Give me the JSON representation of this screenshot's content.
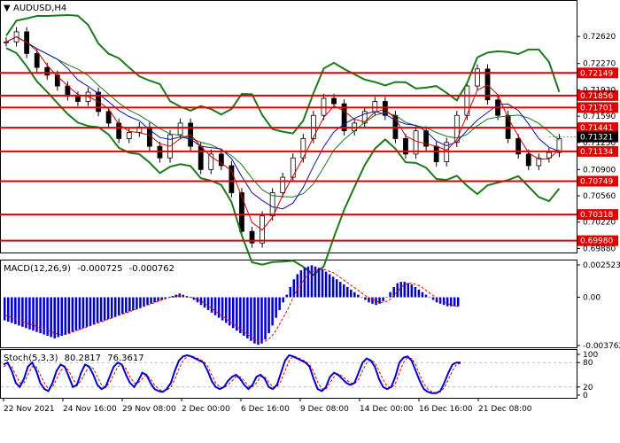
{
  "chart_data": {
    "type": "line",
    "symbol_title": "AUDUSD,H4",
    "price_axis": {
      "labels": [
        "0.72620",
        "0.72270",
        "0.71930",
        "0.71590",
        "0.71250",
        "0.70900",
        "0.70560",
        "0.70220",
        "0.69880"
      ],
      "range": [
        0.6985,
        0.73
      ]
    },
    "levels": [
      {
        "value": 0.72149,
        "label": "0.72149"
      },
      {
        "value": 0.71856,
        "label": "0.71856"
      },
      {
        "value": 0.71701,
        "label": "0.71701"
      },
      {
        "value": 0.71441,
        "label": "0.71441"
      },
      {
        "value": 0.71134,
        "label": "0.71134"
      },
      {
        "value": 0.70749,
        "label": "0.70749"
      },
      {
        "value": 0.70318,
        "label": "0.70318"
      },
      {
        "value": 0.6998,
        "label": "0.69980"
      }
    ],
    "current_price": {
      "value": 0.71321,
      "label": "0.71321"
    },
    "x_labels": [
      "22 Nov 2021",
      "24 Nov 16:00",
      "29 Nov 08:00",
      "2 Dec 00:00",
      "6 Dec 16:00",
      "9 Dec 08:00",
      "14 Dec 00:00",
      "16 Dec 16:00",
      "21 Dec 08:00"
    ],
    "closes": [
      0.7255,
      0.7268,
      0.724,
      0.7222,
      0.7212,
      0.7198,
      0.7185,
      0.7178,
      0.719,
      0.7165,
      0.715,
      0.713,
      0.7138,
      0.7145,
      0.712,
      0.7105,
      0.7135,
      0.715,
      0.712,
      0.709,
      0.711,
      0.7095,
      0.706,
      0.701,
      0.6995,
      0.703,
      0.706,
      0.708,
      0.7105,
      0.713,
      0.716,
      0.7182,
      0.7175,
      0.714,
      0.715,
      0.7165,
      0.7178,
      0.716,
      0.713,
      0.711,
      0.714,
      0.712,
      0.71,
      0.7125,
      0.716,
      0.7198,
      0.722,
      0.718,
      0.716,
      0.713,
      0.711,
      0.7095,
      0.7105,
      0.7112,
      0.713
    ],
    "macd": {
      "title": "MACD(12,26,9)",
      "signal_value": "-0.000725",
      "main_value": "-0.000762",
      "axis_labels": [
        "0.002523",
        "0.00",
        "-0.003762"
      ],
      "range": [
        -0.003762,
        0.002523
      ],
      "histogram": [
        -0.0018,
        -0.0019,
        -0.002,
        -0.0021,
        -0.0022,
        -0.0023,
        -0.0024,
        -0.0025,
        -0.0026,
        -0.0027,
        -0.0028,
        -0.0029,
        -0.003,
        -0.0031,
        -0.0032,
        -0.0031,
        -0.003,
        -0.0029,
        -0.0028,
        -0.0027,
        -0.0026,
        -0.0025,
        -0.0024,
        -0.0023,
        -0.0022,
        -0.0021,
        -0.002,
        -0.0019,
        -0.0018,
        -0.0017,
        -0.0016,
        -0.0015,
        -0.0014,
        -0.0013,
        -0.0012,
        -0.0011,
        -0.001,
        -0.0009,
        -0.0008,
        -0.0007,
        -0.0006,
        -0.0005,
        -0.0004,
        -0.0003,
        -0.0002,
        -0.0001,
        0,
        0.0001,
        0.0002,
        0.0003,
        0.0002,
        0.0001,
        0,
        -0.0002,
        -0.0004,
        -0.0006,
        -0.0008,
        -0.001,
        -0.0012,
        -0.0014,
        -0.0016,
        -0.0018,
        -0.002,
        -0.0022,
        -0.0024,
        -0.0026,
        -0.0028,
        -0.003,
        -0.0032,
        -0.0034,
        -0.0036,
        -0.0037,
        -0.0036,
        -0.0033,
        -0.0028,
        -0.0022,
        -0.0016,
        -0.001,
        -0.0004,
        0.0002,
        0.0008,
        0.0014,
        0.0018,
        0.0021,
        0.0023,
        0.0024,
        0.0025,
        0.0024,
        0.0023,
        0.0022,
        0.002,
        0.0018,
        0.0016,
        0.0014,
        0.0012,
        0.001,
        0.0008,
        0.0006,
        0.0004,
        0.0002,
        0,
        -0.0002,
        -0.0004,
        -0.0005,
        -0.0006,
        -0.0005,
        -0.0003,
        0,
        0.0004,
        0.0008,
        0.0011,
        0.0012,
        0.0012,
        0.0011,
        0.001,
        0.0008,
        0.0006,
        0.0004,
        0.0002,
        0,
        -0.0002,
        -0.0004,
        -0.0005,
        -0.0006,
        -0.0007,
        -0.0007,
        -0.0007,
        -0.0007
      ],
      "signal": [
        -0.0014,
        -0.0015,
        -0.0016,
        -0.0017,
        -0.0018,
        -0.0019,
        -0.002,
        -0.0021,
        -0.0022,
        -0.0023,
        -0.0024,
        -0.0025,
        -0.0026,
        -0.0027,
        -0.0028,
        -0.0029,
        -0.0029,
        -0.0029,
        -0.0028,
        -0.0027,
        -0.0026,
        -0.0025,
        -0.0024,
        -0.0023,
        -0.0022,
        -0.0021,
        -0.002,
        -0.0019,
        -0.0018,
        -0.0017,
        -0.0016,
        -0.0015,
        -0.0014,
        -0.0013,
        -0.0012,
        -0.0011,
        -0.001,
        -0.0009,
        -0.0008,
        -0.0007,
        -0.0006,
        -0.0005,
        -0.0004,
        -0.0003,
        -0.0002,
        -0.0001,
        0,
        0,
        0.0001,
        0.0001,
        0.0001,
        0,
        0,
        -0.0001,
        -0.0002,
        -0.0003,
        -0.0005,
        -0.0007,
        -0.0009,
        -0.0011,
        -0.0013,
        -0.0015,
        -0.0017,
        -0.0019,
        -0.0021,
        -0.0023,
        -0.0025,
        -0.0027,
        -0.0029,
        -0.0031,
        -0.0033,
        -0.0034,
        -0.0035,
        -0.0034,
        -0.0032,
        -0.0029,
        -0.0025,
        -0.002,
        -0.0015,
        -0.001,
        -0.0004,
        0.0002,
        0.0007,
        0.0011,
        0.0015,
        0.0018,
        0.002,
        0.0021,
        0.0022,
        0.0022,
        0.0021,
        0.002,
        0.0019,
        0.0017,
        0.0015,
        0.0013,
        0.0011,
        0.0009,
        0.0007,
        0.0005,
        0.0003,
        0.0001,
        -0.0001,
        -0.0002,
        -0.0003,
        -0.0004,
        -0.0004,
        -0.0003,
        -0.0001,
        0.0002,
        0.0005,
        0.0008,
        0.001,
        0.0011,
        0.0011,
        0.001,
        0.0009,
        0.0007,
        0.0005,
        0.0003,
        0.0001,
        -0.0001,
        -0.0003,
        -0.0004,
        -0.0005,
        -0.0006,
        -0.0007,
        -0.0007
      ]
    },
    "stoch": {
      "title": "Stoch(5,3,3)",
      "main_value": "80.2817",
      "signal_value": "76.3617",
      "axis_labels": [
        "100",
        "80",
        "20",
        "0"
      ],
      "range": [
        0,
        100
      ],
      "main": [
        75,
        80,
        60,
        30,
        20,
        40,
        70,
        80,
        60,
        30,
        15,
        10,
        30,
        60,
        75,
        70,
        45,
        20,
        25,
        55,
        75,
        70,
        50,
        25,
        15,
        20,
        45,
        70,
        80,
        75,
        50,
        30,
        20,
        35,
        55,
        50,
        30,
        15,
        10,
        8,
        15,
        30,
        60,
        85,
        95,
        98,
        95,
        90,
        85,
        80,
        60,
        35,
        20,
        15,
        20,
        35,
        45,
        50,
        40,
        25,
        15,
        25,
        45,
        50,
        40,
        20,
        15,
        25,
        55,
        85,
        98,
        95,
        90,
        85,
        80,
        70,
        40,
        15,
        10,
        20,
        45,
        55,
        50,
        40,
        30,
        25,
        30,
        55,
        80,
        90,
        85,
        70,
        40,
        20,
        15,
        20,
        45,
        80,
        92,
        95,
        85,
        60,
        35,
        15,
        8,
        5,
        5,
        10,
        30,
        55,
        75,
        80,
        80
      ],
      "signal": [
        70,
        75,
        70,
        50,
        30,
        30,
        50,
        70,
        70,
        50,
        30,
        15,
        20,
        40,
        60,
        70,
        60,
        40,
        25,
        35,
        55,
        70,
        65,
        45,
        25,
        20,
        30,
        50,
        70,
        75,
        65,
        45,
        30,
        30,
        40,
        50,
        40,
        25,
        15,
        10,
        12,
        20,
        40,
        65,
        85,
        95,
        96,
        93,
        88,
        83,
        72,
        50,
        30,
        20,
        18,
        25,
        35,
        45,
        45,
        35,
        22,
        20,
        30,
        45,
        45,
        32,
        20,
        20,
        35,
        60,
        85,
        95,
        93,
        88,
        83,
        75,
        58,
        32,
        15,
        15,
        30,
        45,
        52,
        47,
        38,
        30,
        28,
        38,
        60,
        80,
        87,
        80,
        60,
        38,
        22,
        18,
        28,
        55,
        80,
        92,
        90,
        75,
        50,
        28,
        15,
        8,
        6,
        8,
        18,
        38,
        60,
        75,
        78
      ]
    }
  }
}
